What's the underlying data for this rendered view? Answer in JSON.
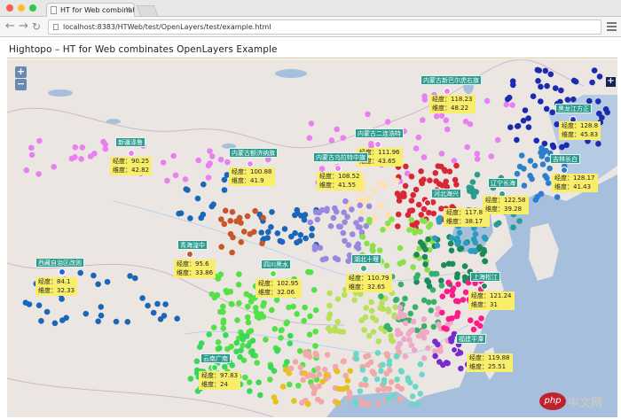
{
  "browser": {
    "tab_title": "HT for Web combinates Op",
    "tab_close": "×",
    "back_glyph": "←",
    "forward_glyph": "→",
    "reload_glyph": "↻",
    "url": "localhost:8383/HTWeb/test/OpenLayers/test/example.html"
  },
  "page": {
    "title": "Hightopo – HT for Web combinates OpenLayers Example"
  },
  "map": {
    "zoom_in": "+",
    "zoom_out": "−",
    "expand": "+",
    "colors": {
      "water": "#a5bfdd",
      "land": "#ece6e3",
      "label_bg": "#2a9c8e",
      "info_bg": "#f8ee6a"
    },
    "cities": [
      {
        "name": "新疆涤鲁",
        "lon_label": "经度：",
        "lon": "90.25",
        "lat_label": "维度：",
        "lat": "42.82",
        "marker_color": "#e880f2"
      },
      {
        "name": "内蒙古新巴尔虎右旗",
        "lon_label": "经度：",
        "lon": "118.23",
        "lat_label": "维度：",
        "lat": "48.22",
        "marker_color": "#e880f2"
      },
      {
        "name": "黑龙江方正",
        "lon_label": "经度：",
        "lon": "128.8",
        "lat_label": "维度：",
        "lat": "45.83",
        "marker_color": "#2233bb"
      },
      {
        "name": "吉林长白",
        "lon_label": "经度：",
        "lon": "128.17",
        "lat_label": "维度：",
        "lat": "41.43",
        "marker_color": "#2a7fd0"
      },
      {
        "name": "内蒙古额济纳旗",
        "lon_label": "经度：",
        "lon": "100.88",
        "lat_label": "维度：",
        "lat": "41.9",
        "marker_color": "#e880f2"
      },
      {
        "name": "内蒙古二连浩特",
        "lon_label": "经度：",
        "lon": "111.96",
        "lat_label": "维度：",
        "lat": "43.65",
        "marker_color": "#e880f2"
      },
      {
        "name": "内蒙古乌拉特中旗",
        "lon_label": "经度：",
        "lon": "108.52",
        "lat_label": "维度：",
        "lat": "41.55",
        "marker_color": "#e880f2"
      },
      {
        "name": "河北海兴",
        "lon_label": "经度：",
        "lon": "117.85",
        "lat_label": "维度：",
        "lat": "38.17",
        "marker_color": "#d82838"
      },
      {
        "name": "辽宁长海",
        "lon_label": "经度：",
        "lon": "122.58",
        "lat_label": "维度：",
        "lat": "39.28",
        "marker_color": "#2aa0a0"
      },
      {
        "name": "青海湟中",
        "lon_label": "经度：",
        "lon": "95.6",
        "lat_label": "维度：",
        "lat": "33.86",
        "marker_color": "#c8562a"
      },
      {
        "name": "四川黑水",
        "lon_label": "经度：",
        "lon": "102.95",
        "lat_label": "维度：",
        "lat": "32.06",
        "marker_color": "#56e048"
      },
      {
        "name": "湖北十堰",
        "lon_label": "经度：",
        "lon": "110.79",
        "lat_label": "维度：",
        "lat": "32.65",
        "marker_color": "#38b06a"
      },
      {
        "name": "西藏自治区改则",
        "lon_label": "经度：",
        "lon": "84.1",
        "lat_label": "维度：",
        "lat": "32.33",
        "marker_color": "#2266dd"
      },
      {
        "name": "上海松江",
        "lon_label": "经度：",
        "lon": "121.24",
        "lat_label": "维度：",
        "lat": "31",
        "marker_color": "#1c8a5a"
      },
      {
        "name": "福建平潭",
        "lon_label": "经度：",
        "lon": "119.88",
        "lat_label": "维度：",
        "lat": "25.51",
        "marker_color": "#7a2acc"
      },
      {
        "name": "云南广南",
        "lon_label": "经度：",
        "lon": "97.83",
        "lat_label": "维度：",
        "lat": "24",
        "marker_color": "#3ad85a"
      }
    ]
  },
  "watermark": {
    "badge": "php",
    "text": "中文网"
  }
}
